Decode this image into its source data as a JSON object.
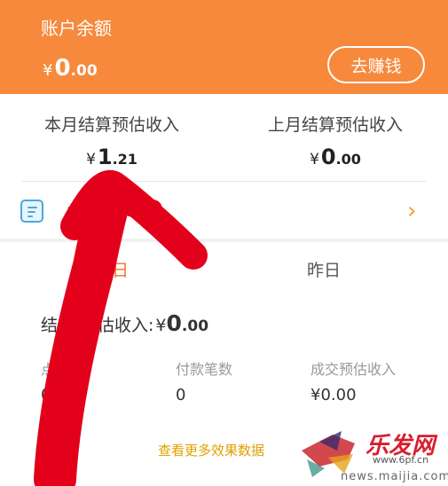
{
  "balance": {
    "title": "账户余额",
    "currency": "¥",
    "int": "0",
    "dec": ".00",
    "earn_button": "去赚钱"
  },
  "income": {
    "this_month": {
      "label": "本月结算预估收入",
      "currency": "¥",
      "int": "1",
      "dec": ".21"
    },
    "last_month": {
      "label": "上月结算预估收入",
      "currency": "¥",
      "int": "0",
      "dec": ".00"
    }
  },
  "order_row": {
    "label": "订",
    "icon": "order-doc-icon",
    "chevron": "›"
  },
  "tabs": {
    "today": "日",
    "yesterday": "昨日"
  },
  "settle": {
    "label": "结算",
    "label_tail": "估收入:",
    "currency": "¥",
    "int": "0",
    "dec": ".00"
  },
  "stats": [
    {
      "label": "点",
      "value": "0"
    },
    {
      "label": "付款笔数",
      "value": "0"
    },
    {
      "label": "成交预估收入",
      "value": "¥0.00"
    }
  ],
  "more_link": "查看更多效果数据",
  "watermark": {
    "text": "乐发网",
    "url": "www.6pf.cn",
    "site": "news.maijia.com"
  },
  "colors": {
    "header": "#f7893c",
    "accent": "#f0702a",
    "link": "#e0a000",
    "arrow": "#e3001b"
  }
}
